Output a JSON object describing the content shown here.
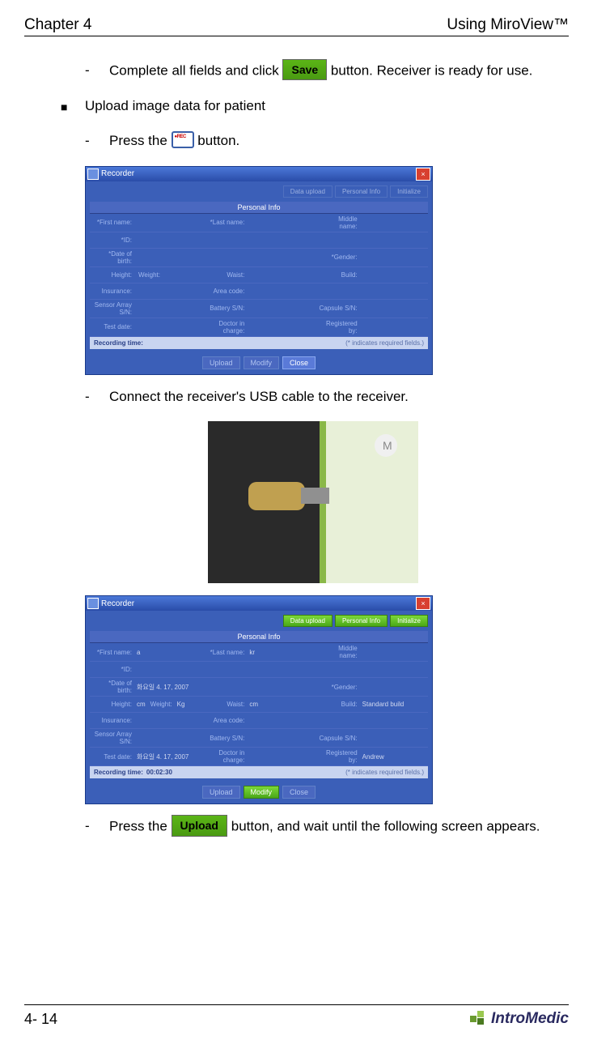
{
  "header": {
    "left": "Chapter 4",
    "right": "Using MiroView™"
  },
  "body": {
    "item1_pre": "Complete all fields and click ",
    "item1_post": " button. Receiver is ready for use.",
    "save_btn": "Save",
    "item2": "Upload image data for patient",
    "item3_pre": "Press the ",
    "item3_post": " button.",
    "item4": "Connect the receiver's USB cable to the receiver.",
    "item5_pre": "Press the ",
    "item5_post": " button, and wait until the following screen appears.",
    "upload_btn": "Upload"
  },
  "dialog1": {
    "title": "Recorder",
    "tabs": [
      "Data upload",
      "Personal Info",
      "Initialize"
    ],
    "section": "Personal Info",
    "labels": {
      "first": "*First name:",
      "last": "*Last name:",
      "middle": "Middle name:",
      "id": "*ID:",
      "dob": "*Date of birth:",
      "gender": "*Gender:",
      "height": "Height:",
      "weight": "Weight:",
      "waist": "Waist:",
      "build": "Build:",
      "insurance": "Insurance:",
      "area": "Area code:",
      "sensor": "Sensor Array S/N:",
      "battery": "Battery S/N:",
      "capsule": "Capsule S/N:",
      "testdate": "Test date:",
      "doctor": "Doctor in charge:",
      "reg": "Registered by:"
    },
    "rec_label": "Recording time:",
    "rec_note": "(* indicates required fields.)",
    "buttons": [
      "Upload",
      "Modify",
      "Close"
    ]
  },
  "dialog2": {
    "title": "Recorder",
    "tabs": [
      "Data upload",
      "Personal Info",
      "Initialize"
    ],
    "section": "Personal Info",
    "vals": {
      "first": "a",
      "last": "kr",
      "dob": "화요일 4. 17, 2007",
      "height": "cm",
      "weight": "Kg",
      "waist": "cm",
      "build": "Standard build",
      "testdate": "화요일 4. 17, 2007",
      "reg": "Andrew"
    },
    "rec_time": "00:02:30",
    "buttons": [
      "Upload",
      "Modify",
      "Close"
    ]
  },
  "footer": {
    "page": "4- 14",
    "logo": "IntroMedic"
  }
}
